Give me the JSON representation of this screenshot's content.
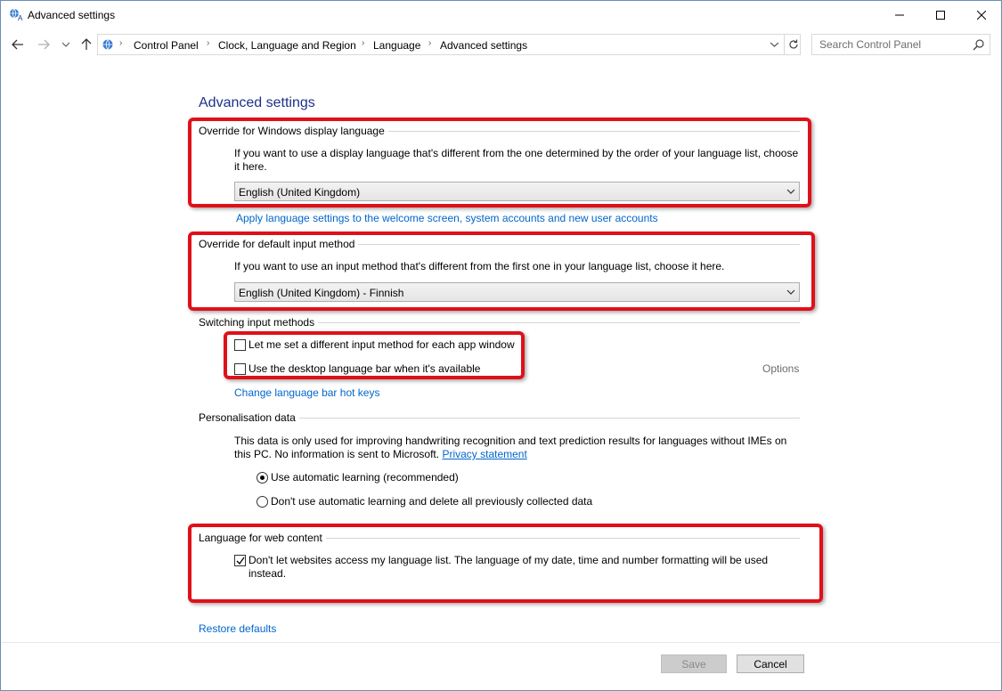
{
  "window": {
    "title": "Advanced settings",
    "minimize_glyph": "—",
    "maximize_glyph": "☐",
    "close_glyph": "✕"
  },
  "address_bar": {
    "crumbs": [
      "Control Panel",
      "Clock, Language and Region",
      "Language",
      "Advanced settings"
    ],
    "search_placeholder": "Search Control Panel"
  },
  "heading": "Advanced settings",
  "display_language": {
    "title": "Override for Windows display language",
    "description_line1": "If you want to use a display language that's different from the one determined by the order of your language list, choose",
    "description_line2": "it here.",
    "selected": "English (United Kingdom)",
    "apply_link": "Apply language settings to the welcome screen, system accounts and new user accounts"
  },
  "input_method": {
    "title": "Override for default input method",
    "description": "If you want to use an input method that's different from the first one in your language list, choose it here.",
    "selected": "English (United Kingdom) - Finnish"
  },
  "switching": {
    "title": "Switching input methods",
    "per_app_label": "Let me set a different input method for each app window",
    "per_app_checked": false,
    "language_bar_label": "Use the desktop language bar when it's available",
    "language_bar_checked": false,
    "options_label": "Options",
    "hotkeys_link": "Change language bar hot keys"
  },
  "personalisation": {
    "title": "Personalisation data",
    "description_line1": "This data is only used for improving handwriting recognition and text prediction results for languages without IMEs on",
    "description_line2_prefix": "this PC. No information is sent to Microsoft.",
    "privacy_link": "Privacy statement",
    "option_auto": "Use automatic learning (recommended)",
    "option_auto_selected": true,
    "option_off": "Don't use automatic learning and delete all previously collected data",
    "option_off_selected": false
  },
  "web_content": {
    "title": "Language for web content",
    "label_line1": "Don't let websites access my language list. The language of my date, time and number formatting will be used",
    "label_line2": "instead.",
    "checked": true
  },
  "restore_defaults": "Restore defaults",
  "buttons": {
    "save": "Save",
    "cancel": "Cancel"
  },
  "colors": {
    "highlight": "#e0101a",
    "heading": "#1e3287",
    "link": "#0066cc"
  }
}
